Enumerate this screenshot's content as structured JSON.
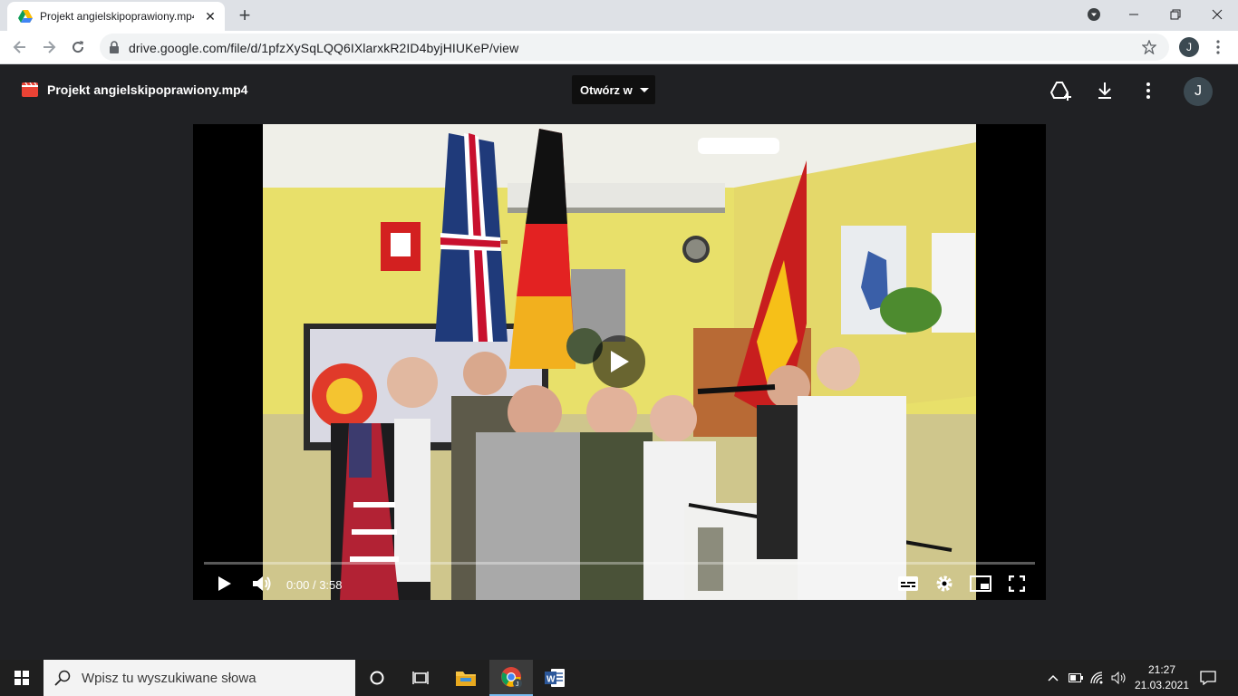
{
  "browser": {
    "tab_title": "Projekt angielskipoprawiony.mp4",
    "url": "drive.google.com/file/d/1pfzXySqLQQ6IXlarxkR2ID4byjHIUKeP/view",
    "profile_initial": "J"
  },
  "viewer": {
    "file_name": "Projekt angielskipoprawiony.mp4",
    "open_with_label": "Otwórz w",
    "profile_initial": "J"
  },
  "video": {
    "current_time": "0:00",
    "separator": "/",
    "duration": "3:58",
    "progress": 0
  },
  "taskbar": {
    "search_placeholder": "Wpisz tu wyszukiwane słowa",
    "time": "21:27",
    "date": "21.03.2021"
  }
}
